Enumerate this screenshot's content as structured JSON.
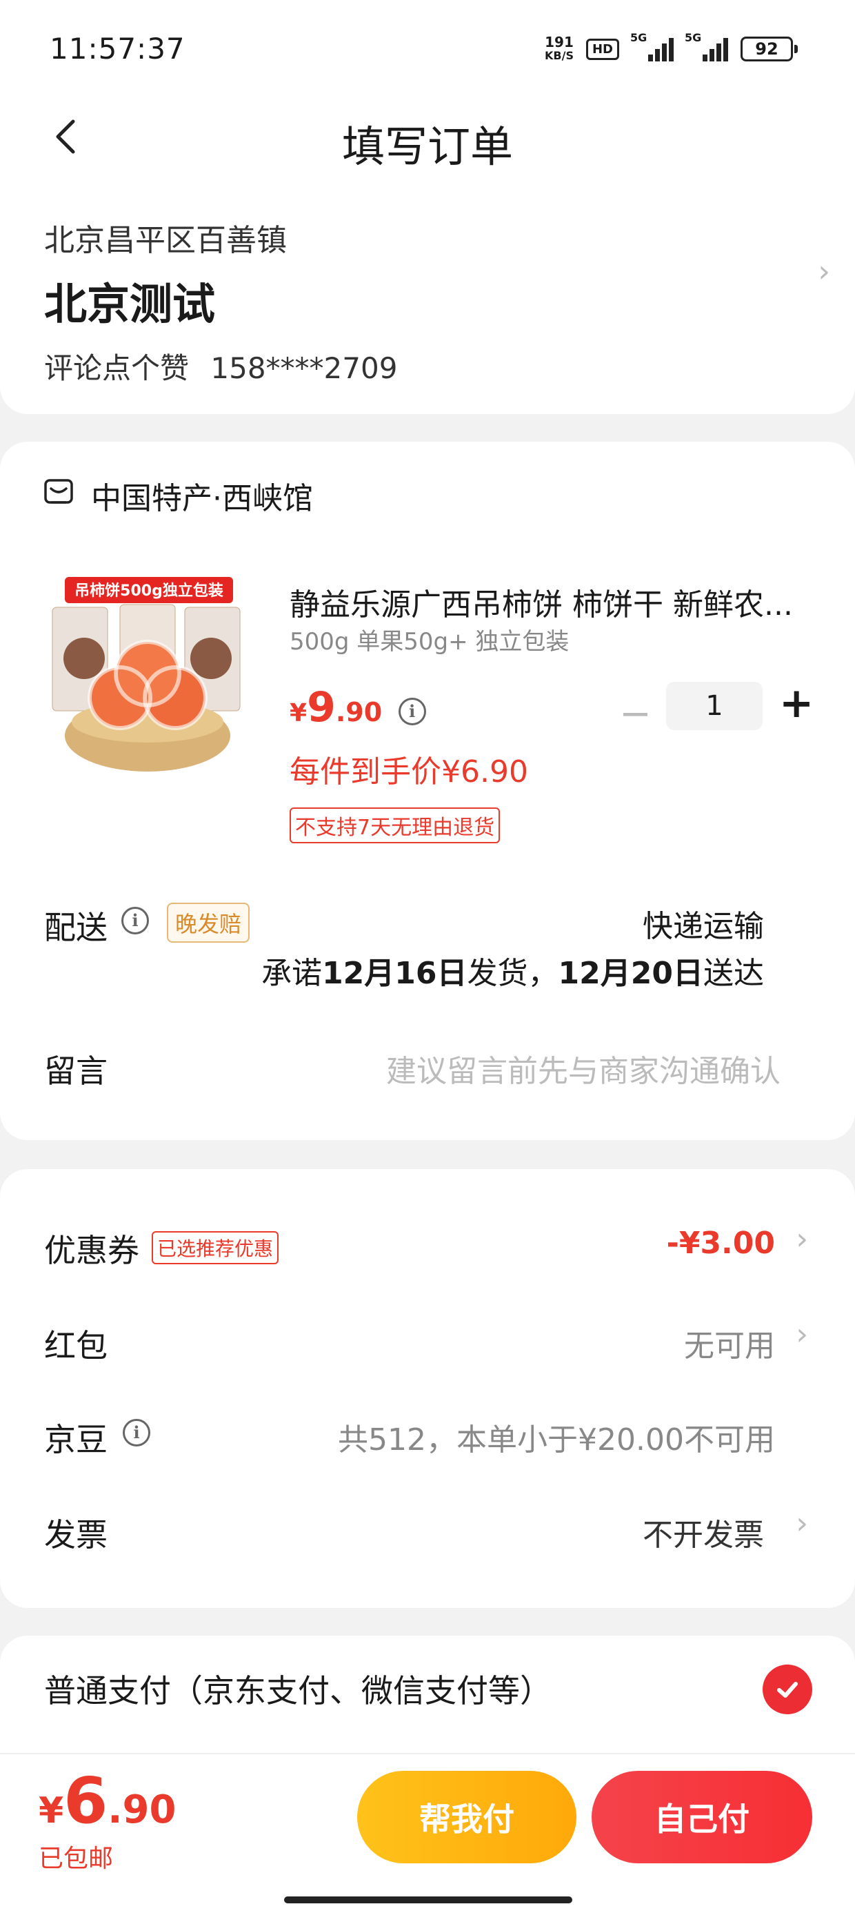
{
  "status_bar": {
    "time": "11:57:37",
    "net_speed_value": "191",
    "net_speed_unit": "KB/S",
    "hd_label": "HD",
    "signal1_label": "5G",
    "signal2_label": "5G",
    "battery": "92"
  },
  "header": {
    "title": "填写订单"
  },
  "address": {
    "region": "北京昌平区百善镇",
    "name": "北京测试",
    "contact_name": "评论点个赞",
    "phone": "158****2709"
  },
  "shop": {
    "name": "中国特产·西峡馆",
    "product": {
      "image_banner": "吊柿饼500g独立包装",
      "title": "静益乐源广西吊柿饼 柿饼干 新鲜农...",
      "spec": "500g 单果50g+ 独立包装",
      "price_symbol": "¥",
      "price_int": "9",
      "price_dec": ".90",
      "quantity": "1",
      "final_price": "每件到手价¥6.90",
      "return_policy": "不支持7天无理由退货"
    },
    "delivery": {
      "label": "配送",
      "late_tag": "晚发赔",
      "method": "快递运输",
      "promise_prefix": "承诺",
      "ship_date": "12月16日",
      "promise_mid": "发货，",
      "arrive_date": "12月20日",
      "promise_suffix": "送达"
    },
    "message": {
      "label": "留言",
      "placeholder": "建议留言前先与商家沟通确认"
    }
  },
  "discounts": {
    "coupon_label": "优惠券",
    "coupon_tag": "已选推荐优惠",
    "coupon_value": "-¥3.00",
    "redpacket_label": "红包",
    "redpacket_value": "无可用",
    "jingdou_label": "京豆",
    "jingdou_value": "共512，本单小于¥20.00不可用",
    "invoice_label": "发票",
    "invoice_value": "不开发票"
  },
  "payment": {
    "method_label": "普通支付（京东支付、微信支付等）"
  },
  "footer": {
    "total_symbol": "¥",
    "total_int": "6",
    "total_dec": ".90",
    "shipping_note": "已包邮",
    "friend_pay_label": "帮我付",
    "self_pay_label": "自己付"
  },
  "colors": {
    "accent_red": "#e93a2b",
    "pay_yellow": "#ffb70f",
    "check_red": "#ec2d34"
  },
  "icons": [
    "back-icon",
    "shop-icon",
    "info-icon",
    "chevron-right-icon",
    "check-icon",
    "plus-icon",
    "minus-icon"
  ]
}
